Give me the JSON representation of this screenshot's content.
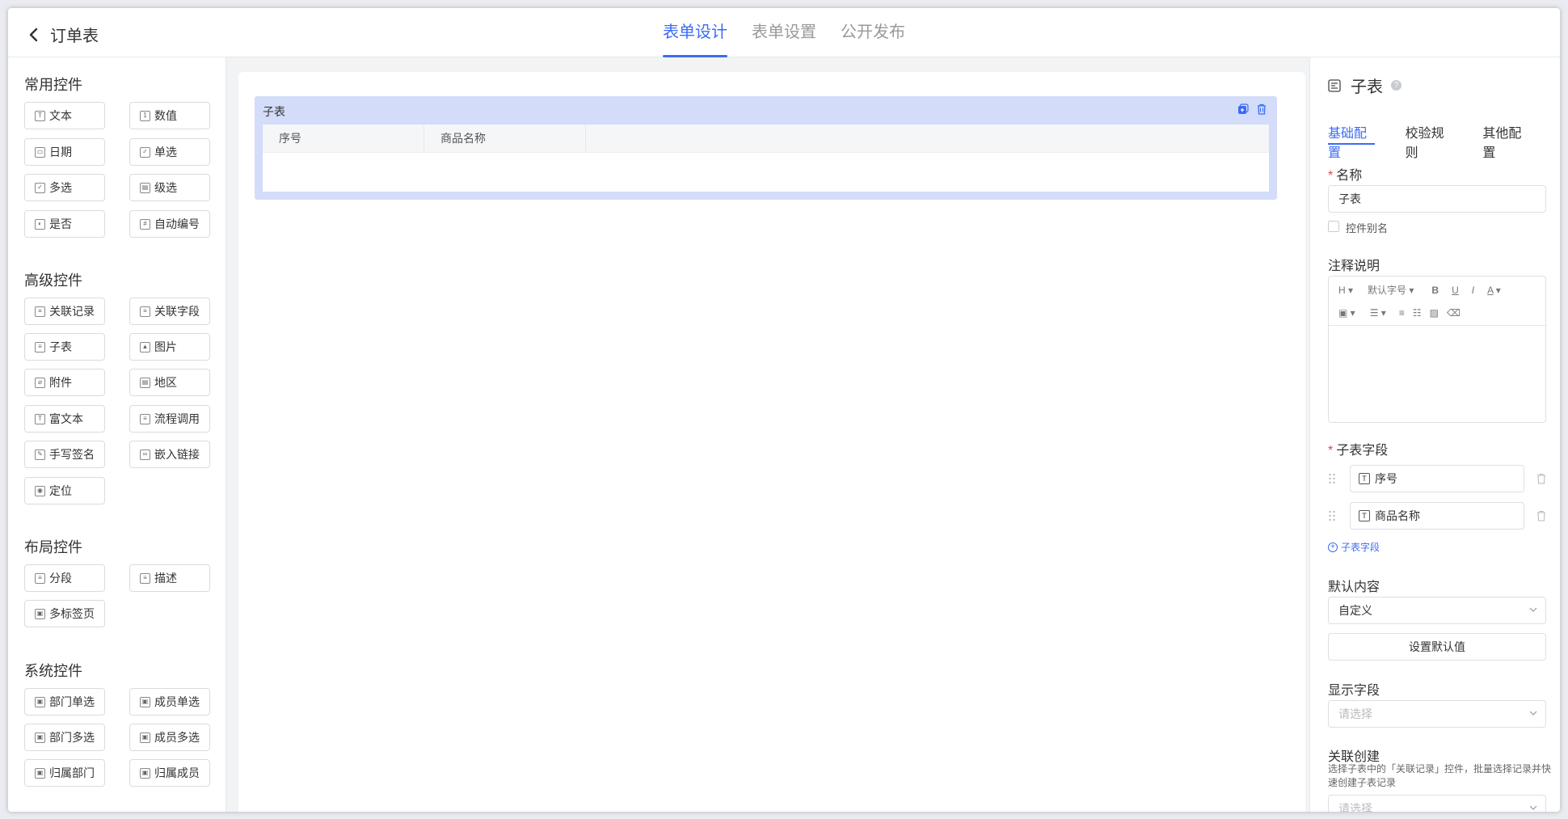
{
  "header": {
    "back_title": "订单表",
    "tabs": [
      {
        "label": "表单设计",
        "active": true
      },
      {
        "label": "表单设置",
        "active": false
      },
      {
        "label": "公开发布",
        "active": false
      }
    ]
  },
  "left_panel": {
    "groups": [
      {
        "title": "常用控件",
        "items": [
          {
            "label": "文本",
            "icon": "text-icon"
          },
          {
            "label": "数值",
            "icon": "number-icon"
          },
          {
            "label": "日期",
            "icon": "date-icon"
          },
          {
            "label": "单选",
            "icon": "radio-icon"
          },
          {
            "label": "多选",
            "icon": "checkbox-icon"
          },
          {
            "label": "级选",
            "icon": "cascade-icon"
          },
          {
            "label": "是否",
            "icon": "yesno-icon"
          },
          {
            "label": "自动编号",
            "icon": "autonumber-icon"
          }
        ]
      },
      {
        "title": "高级控件",
        "items": [
          {
            "label": "关联记录",
            "icon": "link-record-icon"
          },
          {
            "label": "关联字段",
            "icon": "link-field-icon"
          },
          {
            "label": "子表",
            "icon": "subtable-icon"
          },
          {
            "label": "图片",
            "icon": "image-icon"
          },
          {
            "label": "附件",
            "icon": "attachment-icon"
          },
          {
            "label": "地区",
            "icon": "region-icon"
          },
          {
            "label": "富文本",
            "icon": "richtext-icon"
          },
          {
            "label": "流程调用",
            "icon": "process-icon"
          },
          {
            "label": "手写签名",
            "icon": "signature-icon"
          },
          {
            "label": "嵌入链接",
            "icon": "embed-link-icon"
          },
          {
            "label": "定位",
            "icon": "location-icon"
          }
        ]
      },
      {
        "title": "布局控件",
        "items": [
          {
            "label": "分段",
            "icon": "section-icon"
          },
          {
            "label": "描述",
            "icon": "description-icon"
          },
          {
            "label": "多标签页",
            "icon": "multitab-icon"
          }
        ]
      },
      {
        "title": "系统控件",
        "items": [
          {
            "label": "部门单选",
            "icon": "dept-single-icon"
          },
          {
            "label": "成员单选",
            "icon": "member-single-icon"
          },
          {
            "label": "部门多选",
            "icon": "dept-multi-icon"
          },
          {
            "label": "成员多选",
            "icon": "member-multi-icon"
          },
          {
            "label": "归属部门",
            "icon": "owner-dept-icon"
          },
          {
            "label": "归属成员",
            "icon": "owner-member-icon"
          }
        ]
      }
    ]
  },
  "canvas": {
    "subtable": {
      "title": "子表",
      "columns": [
        "序号",
        "商品名称"
      ]
    }
  },
  "right_panel": {
    "title": "子表",
    "tabs": [
      {
        "label": "基础配置",
        "active": true
      },
      {
        "label": "校验规则",
        "active": false
      },
      {
        "label": "其他配置",
        "active": false
      }
    ],
    "name_label": "名称",
    "name_value": "子表",
    "alias_label": "控件别名",
    "note_label": "注释说明",
    "editor_toolbar": {
      "heading": "H",
      "font_size": "默认字号",
      "bold": "B",
      "underline": "U",
      "italic": "I",
      "font_color": "A"
    },
    "subfields_label": "子表字段",
    "subfields": [
      "序号",
      "商品名称"
    ],
    "add_subfield": "子表字段",
    "default_label": "默认内容",
    "default_value": "自定义",
    "set_default_button": "设置默认值",
    "display_label": "显示字段",
    "display_placeholder": "请选择",
    "relation_label": "关联创建",
    "relation_desc": "选择子表中的「关联记录」控件，批量选择记录并快速创建子表记录",
    "relation_placeholder": "请选择"
  },
  "colors": {
    "accent": "#3b6cf6",
    "subtable_bg": "#d3dcf9",
    "required": "#e54545"
  }
}
